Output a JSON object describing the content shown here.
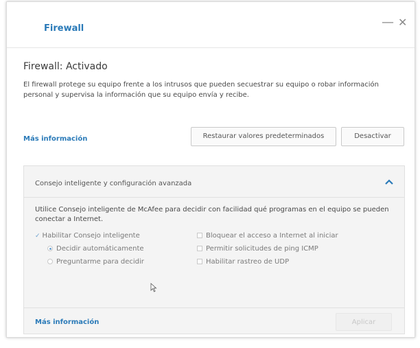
{
  "window": {
    "title": "Firewall",
    "minimize_label": "—",
    "close_label": "✕"
  },
  "main": {
    "heading": "Firewall: Activado",
    "description": "El firewall protege su equipo frente a los intrusos que pueden secuestrar su equipo o robar información personal y supervisa la información que su equipo envía y recibe.",
    "more_info": "Más información",
    "restore_button": "Restaurar valores predeterminados",
    "deactivate_button": "Desactivar"
  },
  "panel": {
    "title": "Consejo inteligente y configuración avanzada",
    "description": "Utilice Consejo inteligente de McAfee para decidir con facilidad qué programas en el equipo se pueden conectar a Internet.",
    "options_left": [
      {
        "label": "Habilitar Consejo inteligente",
        "type": "checkbox",
        "checked": true
      },
      {
        "label": "Decidir automáticamente",
        "type": "radio",
        "checked": true
      },
      {
        "label": "Preguntarme para decidir",
        "type": "radio",
        "checked": false
      }
    ],
    "options_right": [
      {
        "label": "Bloquear el acceso a Internet al iniciar",
        "type": "checkbox",
        "checked": false
      },
      {
        "label": "Permitir solicitudes de ping ICMP",
        "type": "checkbox",
        "checked": false
      },
      {
        "label": "Habilitar rastreo de UDP",
        "type": "checkbox",
        "checked": false
      }
    ],
    "more_info": "Más información",
    "apply_button": "Aplicar"
  },
  "colors": {
    "accent": "#2a7ab8",
    "panel_bg": "#f4f4f4",
    "disabled_text": "#c8c8c8"
  }
}
